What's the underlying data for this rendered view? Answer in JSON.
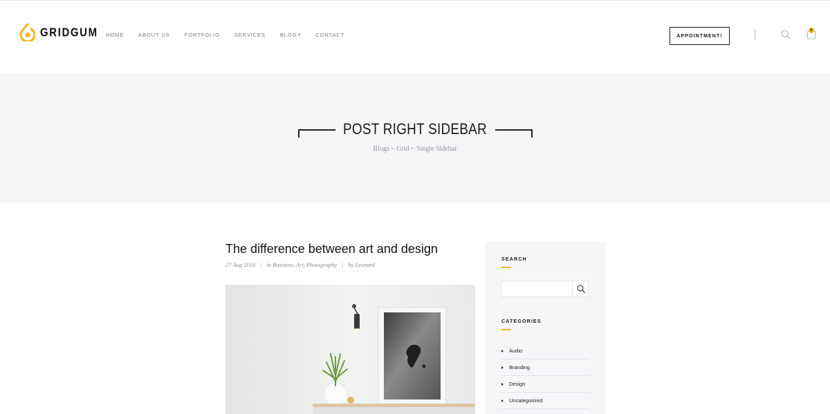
{
  "header": {
    "brand": "GRIDGUM",
    "nav": [
      {
        "label": "HOME"
      },
      {
        "label": "ABOUT US"
      },
      {
        "label": "PORTFOLIO"
      },
      {
        "label": "SERVICES"
      },
      {
        "label": "BLOG"
      },
      {
        "label": "CONTACT"
      }
    ],
    "appointment_label": "APPOINTMENT!",
    "cart_count": "0",
    "accent_color": "#f5b820"
  },
  "banner": {
    "title": "POST RIGHT SIDEBAR",
    "breadcrumb": [
      "Blogs",
      "Grid",
      "Single Sidebar"
    ],
    "separator": "~"
  },
  "post": {
    "title": "The difference between art and design",
    "date": "27 Aug 2016",
    "categories": "in Business, Art, Photography",
    "author": "by Leonard"
  },
  "sidebar": {
    "search_title": "SEARCH",
    "search_placeholder": "",
    "categories_title": "CATEGORIES",
    "categories": [
      {
        "label": "Audio"
      },
      {
        "label": "Branding"
      },
      {
        "label": "Design"
      },
      {
        "label": "Uncategorized"
      }
    ]
  }
}
